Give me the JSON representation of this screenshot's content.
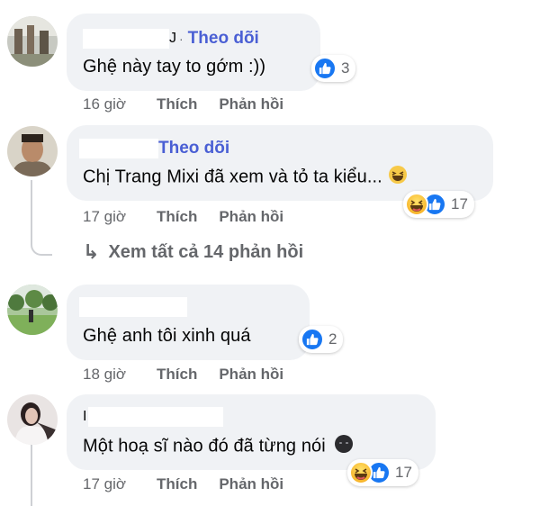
{
  "follow_label": "Theo dõi",
  "like_label": "Thích",
  "reply_label": "Phản hồi",
  "comments": [
    {
      "name_fragment": "J",
      "text": "Ghệ này tay to gớm :))",
      "reaction_count": "3",
      "time": "16 giờ"
    },
    {
      "text": "Chị Trang Mixi đã xem và tỏ ta kiểu...",
      "reaction_count": "17",
      "time": "17 giờ",
      "view_replies": "Xem tất cả 14 phản hồi"
    },
    {
      "text": "Ghệ anh tôi xinh quá",
      "reaction_count": "2",
      "time": "18 giờ"
    },
    {
      "name_fragment": "I",
      "text": "Một hoạ sĩ nào đó đã từng nói",
      "reaction_count": "17",
      "time": "17 giờ"
    }
  ],
  "icons": {
    "like": "like-icon",
    "haha": "haha-icon",
    "reply_arrow": "reply-arrow-icon",
    "dark_emoji": "dark-face-emoji-icon",
    "laugh_emoji": "laughing-emoji-icon"
  },
  "colors": {
    "follow": "#4a5fd4",
    "like": "#1877f2",
    "bubble": "#f0f2f5",
    "muted": "#65676b"
  }
}
